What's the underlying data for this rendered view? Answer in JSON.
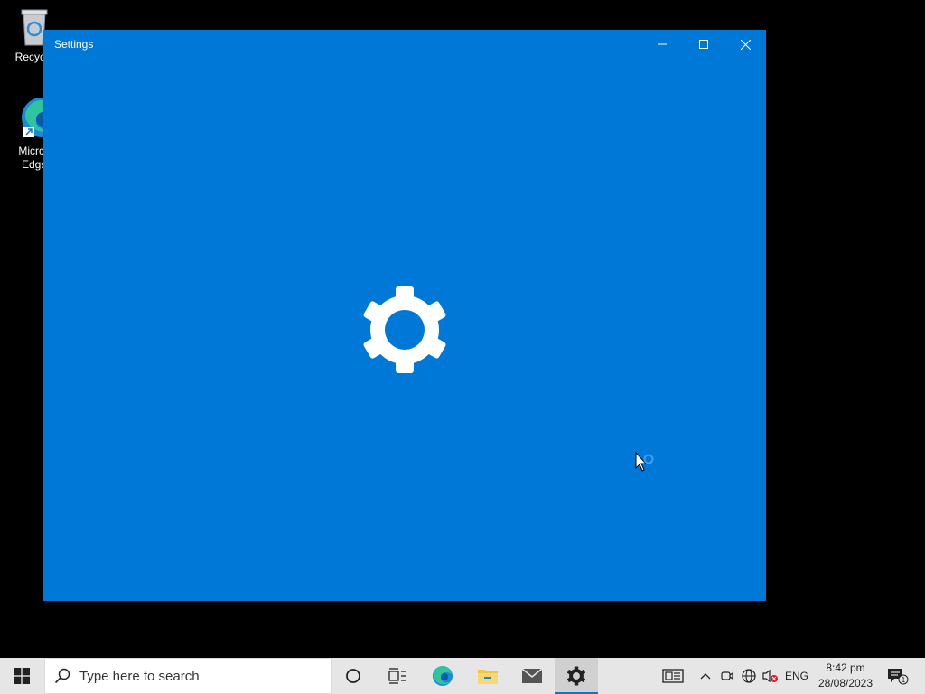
{
  "desktop": {
    "icons": [
      {
        "label": "Recycle"
      },
      {
        "label_line1": "Micros",
        "label_line2": "Edge"
      }
    ]
  },
  "window": {
    "title": "Settings"
  },
  "taskbar": {
    "search_placeholder": "Type here to search",
    "language": "ENG",
    "time": "8:42 pm",
    "date": "28/08/2023",
    "notification_count": "1"
  },
  "colors": {
    "window_bg": "#0078d7",
    "taskbar_bg": "#e6e6e6",
    "accent": "#0078d7"
  }
}
